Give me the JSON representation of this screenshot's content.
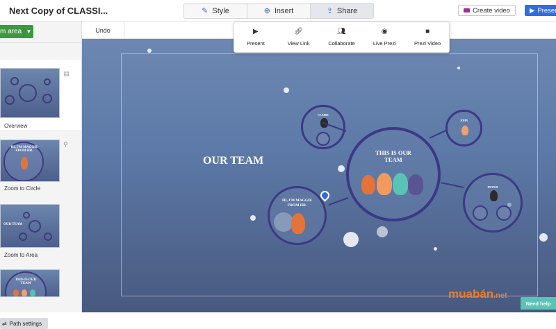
{
  "document": {
    "title": "Next Copy of CLASSI..."
  },
  "toolbar": {
    "tabs": [
      {
        "label": "Style",
        "icon": "brush-icon"
      },
      {
        "label": "Insert",
        "icon": "plus-circle-icon"
      },
      {
        "label": "Share",
        "icon": "share-icon",
        "active": true
      }
    ],
    "create_video_label": "Create video",
    "present_label": "Present"
  },
  "sidebar": {
    "add_area_label": "m area",
    "items": [
      {
        "label": "Overview",
        "selected": true
      },
      {
        "label": "Zoom to Circle"
      },
      {
        "label": "Zoom to Area"
      },
      {
        "label": ""
      }
    ],
    "thumb_texts": {
      "circle": "HI, I'M MAGGIE FROM HR.",
      "area": "OUR TEAM",
      "bottom": "THIS IS OUR TEAM"
    },
    "path_settings_label": "Path settings"
  },
  "undo_label": "Undo",
  "share_menu": {
    "options": [
      {
        "label": "Present",
        "icon": "play-icon"
      },
      {
        "label": "View Link",
        "icon": "link-icon"
      },
      {
        "label": "Collaborate",
        "icon": "people-icon"
      },
      {
        "label": "Live Prezi",
        "icon": "broadcast-icon"
      },
      {
        "label": "Prezi Video",
        "icon": "video-camera-icon"
      }
    ]
  },
  "canvas": {
    "heading": "OUR TEAM",
    "center_circle_text": "THIS IS OUR TEAM",
    "maggie_circle_text": "HI, I'M MAGGIE FROM HR.",
    "top_left_circle_text": "CLAIRE",
    "top_right_circle_text": "JOHN",
    "right_circle_text": "PETER"
  },
  "watermark": {
    "main": "muabán",
    "suffix": ".net"
  },
  "need_help_label": "Need help",
  "colors": {
    "accent_blue": "#2f6de1",
    "add_area_green": "#3b9a3e",
    "circle_stroke": "#3c3885",
    "canvas_top": "#6c87b1",
    "canvas_bottom": "#48597f",
    "watermark_orange": "#f07b23",
    "need_help_teal": "#57c4b6"
  }
}
